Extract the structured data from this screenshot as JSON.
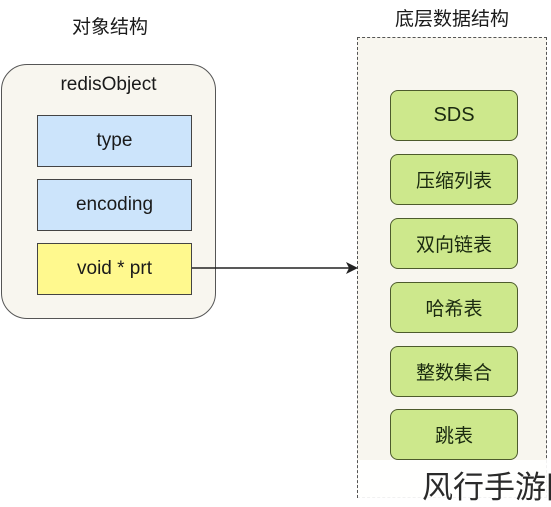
{
  "left_section": {
    "title": "对象结构",
    "object": {
      "name": "redisObject",
      "fields": [
        {
          "label": "type",
          "color": "#cce4fb"
        },
        {
          "label": "encoding",
          "color": "#cce4fb"
        },
        {
          "label": "void * prt",
          "color": "#fff98e"
        }
      ]
    }
  },
  "right_section": {
    "title": "底层数据结构",
    "structures": [
      {
        "label": "SDS"
      },
      {
        "label": "压缩列表"
      },
      {
        "label": "双向链表"
      },
      {
        "label": "哈希表"
      },
      {
        "label": "整数集合"
      },
      {
        "label": "跳表"
      }
    ],
    "box_color": "#cde88c"
  },
  "connection": {
    "from": "void * prt",
    "to": "底层数据结构",
    "type": "arrow"
  },
  "watermark": "风行手游网"
}
